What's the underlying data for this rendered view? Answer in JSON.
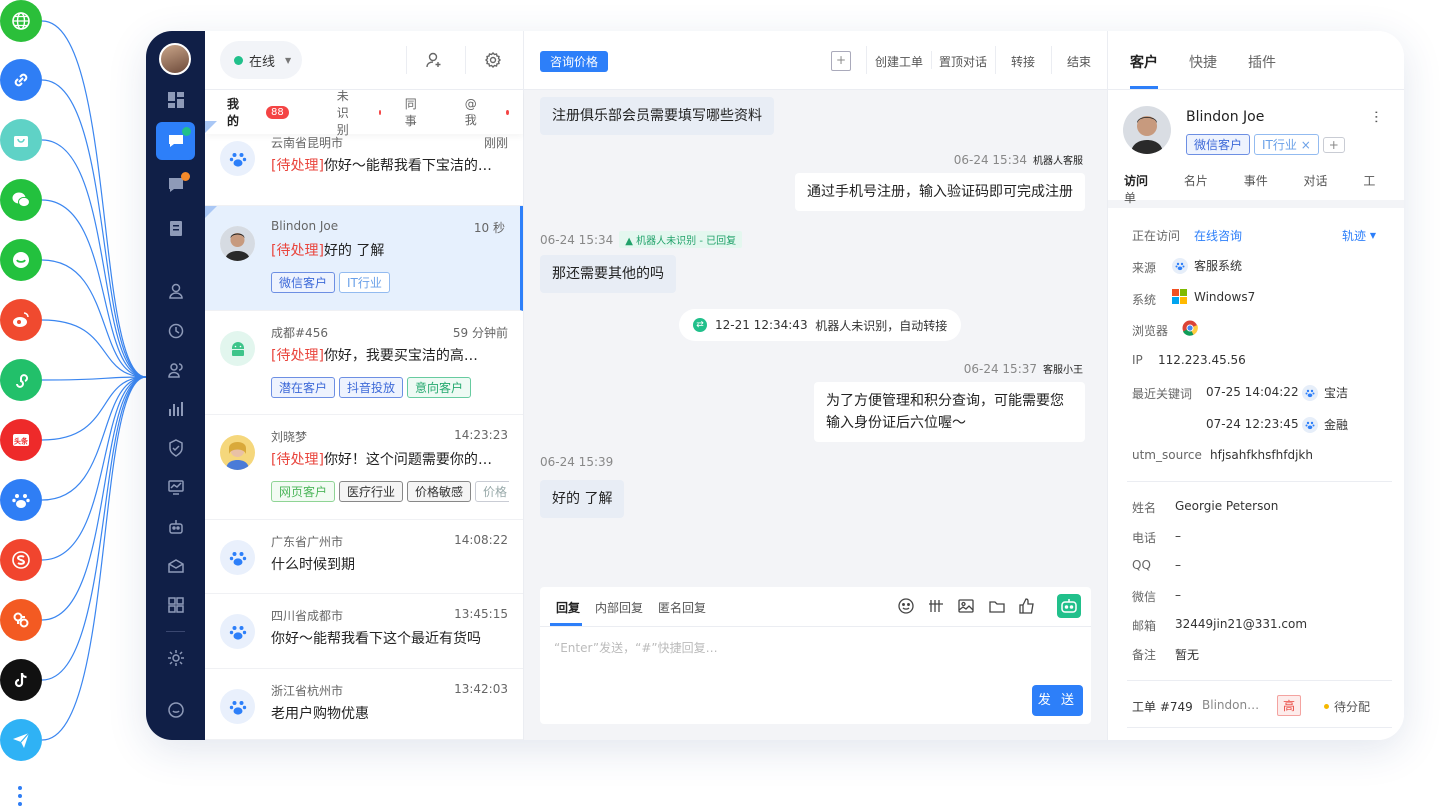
{
  "channels": [
    {
      "icon": "globe-icon",
      "color": "#2bbf3a"
    },
    {
      "icon": "link-icon",
      "color": "#2f7ef5"
    },
    {
      "icon": "shopping-bag-icon",
      "color": "#5fd2c6"
    },
    {
      "icon": "wechat-icon",
      "color": "#23c13e"
    },
    {
      "icon": "chat-bubble-icon",
      "color": "#23c13e"
    },
    {
      "icon": "weibo-icon",
      "color": "#f04a2f"
    },
    {
      "icon": "mini-program-icon",
      "color": "#22c06a"
    },
    {
      "icon": "toutiao-icon",
      "color": "#ee2a2a"
    },
    {
      "icon": "baidu-icon",
      "color": "#2f7ef5"
    },
    {
      "icon": "sogou-icon",
      "color": "#f1452e"
    },
    {
      "icon": "weibo-alt-icon",
      "color": "#f35a22"
    },
    {
      "icon": "tiktok-icon",
      "color": "#111111"
    },
    {
      "icon": "paper-plane-icon",
      "color": "#2fb2f5"
    }
  ],
  "status": {
    "label": "在线"
  },
  "list_tabs": {
    "mine": "我的",
    "mine_count": "88",
    "unrecognized": "未识别",
    "colleague": "同事",
    "at_me": "@我"
  },
  "conversations": [
    {
      "name": "云南省昆明市",
      "time": "刚刚",
      "pending": "[待处理]",
      "msg": "你好～能帮我看下宝洁的…",
      "tags": []
    },
    {
      "name": "Blindon Joe",
      "time": "10 秒",
      "pending": "[待处理]",
      "msg": "好的 了解",
      "tags": [
        "微信客户",
        "IT行业"
      ]
    },
    {
      "name": "成都#456",
      "time": "59 分钟前",
      "pending": "[待处理]",
      "msg": "你好，我要买宝洁的高…",
      "tags": [
        "潜在客户",
        "抖音投放",
        "意向客户"
      ]
    },
    {
      "name": "刘晓梦",
      "time": "14:23:23",
      "pending": "[待处理]",
      "msg": "你好！这个问题需要你的帮…",
      "tags": [
        "网页客户",
        "医疗行业",
        "价格敏感",
        "价格"
      ]
    },
    {
      "name": "广东省广州市",
      "time": "14:08:22",
      "pending": "",
      "msg": "什么时候到期",
      "tags": []
    },
    {
      "name": "四川省成都市",
      "time": "13:45:15",
      "pending": "",
      "msg": "你好～能帮我看下这个最近有货吗",
      "tags": []
    },
    {
      "name": "浙江省杭州市",
      "time": "13:42:03",
      "pending": "",
      "msg": "老用户购物优惠",
      "tags": []
    }
  ],
  "chat_header": {
    "topic": "咨询价格",
    "plus": "+",
    "create_ticket": "创建工单",
    "pin": "置顶对话",
    "transfer": "转接",
    "end": "结束"
  },
  "messages": {
    "m1": "注册俱乐部会员需要填写哪些资料",
    "m2_meta": "06-24 15:34",
    "m2_sender": "机器人客服",
    "m2": "通过手机号注册，输入验证码即可完成注册",
    "m3_meta": "06-24 15:34",
    "m3_badge": "机器人未识别 - 已回复",
    "m3": "那还需要其他的吗",
    "sys_time": "12-21 12:34:43",
    "sys_text": "机器人未识别，自动转接",
    "m4_meta": "06-24 15:37",
    "m4_sender": "客服小王",
    "m4": "为了方便管理和积分查询，可能需要您输入身份证后六位喔～",
    "m5_meta": "06-24 15:39",
    "m5": "好的 了解"
  },
  "composer": {
    "tab_reply": "回复",
    "tab_internal": "内部回复",
    "tab_anon": "匿名回复",
    "placeholder": "“Enter”发送，“#”快捷回复…",
    "send": "发 送"
  },
  "right_tabs": {
    "customer": "客户",
    "quick": "快捷",
    "plugin": "插件"
  },
  "customer": {
    "name": "Blindon Joe",
    "tag1": "微信客户",
    "tag2": "IT行业",
    "tag_close": "×",
    "add": "+",
    "sub_tabs": [
      "访问",
      "名片",
      "事件",
      "对话",
      "工单"
    ],
    "visiting_label": "正在访问",
    "visiting_value": "在线咨询",
    "track": "轨迹",
    "source_label": "来源",
    "source_value": "客服系统",
    "os_label": "系统",
    "os_value": "Windows7",
    "browser_label": "浏览器",
    "ip_label": "IP",
    "ip_value": "112.223.45.56",
    "kw_label": "最近关键词",
    "kw1_time": "07-25 14:04:22",
    "kw1": "宝洁",
    "kw2_time": "07-24 12:23:45",
    "kw2": "金融",
    "utm_label": "utm_source",
    "utm_value": "hfjsahfkhsfhfdjkh",
    "name_label": "姓名",
    "name_value": "Georgie Peterson",
    "phone_label": "电话",
    "phone_value": "–",
    "qq_label": "QQ",
    "qq_value": "–",
    "wechat_label": "微信",
    "wechat_value": "–",
    "email_label": "邮箱",
    "email_value": "32449jin21@331.com",
    "note_label": "备注",
    "note_value": "暂无",
    "ticket_label": "工单 #749",
    "ticket_name": "Blindon…",
    "ticket_priority": "高",
    "ticket_status": "待分配"
  }
}
